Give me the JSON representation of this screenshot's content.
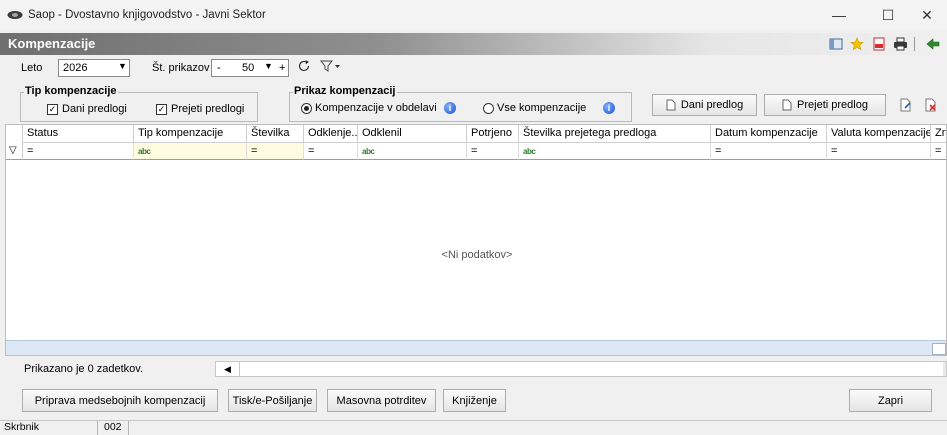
{
  "window": {
    "title": "Saop - Dvostavno knjigovodstvo - Javni Sektor",
    "minimize": "—",
    "maximize": "☐",
    "close": "✕"
  },
  "header": {
    "title": "Kompenzacije"
  },
  "toolbar_icons": [
    "layout-icon",
    "star-icon",
    "pdf-icon",
    "printer-icon",
    "exit-icon"
  ],
  "filters": {
    "leto_label": "Leto",
    "leto_value": "2026",
    "st_prikazov_label": "Št. prikazov",
    "minus": "-",
    "st_prikazov_value": "50",
    "plus": "+"
  },
  "tip_kompenzacije": {
    "title": "Tip kompenzacije",
    "dani": "Dani predlogi",
    "prejeti": "Prejeti predlogi"
  },
  "prikaz_kompenzacij": {
    "title": "Prikaz kompenzacij",
    "v_obdelavi": "Kompenzacije v obdelavi",
    "vse": "Vse kompenzacije"
  },
  "actions": {
    "dani_predlog": "Dani predlog",
    "prejeti_predlog": "Prejeti predlog"
  },
  "grid": {
    "columns": [
      "Status",
      "Tip kompenzacije",
      "Številka",
      "Odklenje...",
      "Odklenil",
      "Potrjeno",
      "Številka prejetega predloga",
      "Datum kompenzacije",
      "Valuta kompenzacije",
      "Zne"
    ],
    "filter_ops": [
      "=",
      "abc",
      "=",
      "=",
      "abc",
      "=",
      "abc",
      "=",
      "=",
      "="
    ],
    "no_data": "<Ni podatkov>"
  },
  "footer": {
    "record_count": "Prikazano je 0 zadetkov.",
    "btn_priprava": "Priprava medsebojnih kompenzacij",
    "btn_tisk": "Tisk/e-Pošiljanje",
    "btn_masovna": "Masovna potrditev",
    "btn_knjizenje": "Knjiženje",
    "btn_zapri": "Zapri"
  },
  "statusbar": {
    "user": "Skrbnik",
    "code": "002"
  }
}
